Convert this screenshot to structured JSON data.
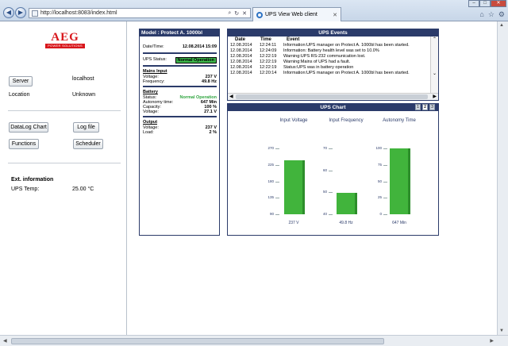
{
  "browser": {
    "url": "http://localhost:8083/index.html",
    "tab_title": "UPS View Web client",
    "tab_close": "✕",
    "min": "–",
    "max": "□",
    "close": "✕"
  },
  "sidebar": {
    "logo_text": "AEG",
    "logo_sub": "POWER SOLUTIONS",
    "server_btn": "Server",
    "server_value": "localhost",
    "location_label": "Location",
    "location_value": "Unknown",
    "datalog_btn": "DataLog Chart",
    "logfile_btn": "Log file",
    "functions_btn": "Functions",
    "scheduler_btn": "Scheduler",
    "ext_title": "Ext. information",
    "ups_temp_label": "UPS Temp:",
    "ups_temp_value": "25.00 °C"
  },
  "model": {
    "header": "Model : Protect A. 1000bl",
    "datetime_label": "Date/Time:",
    "datetime_value": "12.08.2014 15:09",
    "status_label": "UPS Status:",
    "status_value": "Normal Operation",
    "mains_title": "Mains Input",
    "voltage_label": "Voltage:",
    "mains_voltage": "237 V",
    "frequency_label": "Frequency:",
    "mains_frequency": "49.8 Hz",
    "battery_title": "Battery",
    "bstatus_label": "Status:",
    "battery_status": "Normal Operation",
    "autonomy_label": "Autonomy time:",
    "battery_autonomy": "647 Min",
    "capacity_label": "Capacity:",
    "battery_capacity": "100 %",
    "bvoltage_label": "Voltage:",
    "battery_voltage": "27.1 V",
    "output_title": "Output",
    "ovoltage_label": "Voltage:",
    "output_voltage": "237 V",
    "load_label": "Load:",
    "output_load": "2 %"
  },
  "events": {
    "header": "UPS Events",
    "col_date": "Date",
    "col_time": "Time",
    "col_event": "Event",
    "rows": [
      {
        "date": "12.08.2014",
        "time": "12:24:11",
        "event": "Information:UPS manager on Protect A. 1000bl has been started."
      },
      {
        "date": "12.08.2014",
        "time": "12:24:09",
        "event": "Information: Battery health level was set to 10.0%"
      },
      {
        "date": "12.08.2014",
        "time": "12:22:19",
        "event": "Warning:UPS RS-232 communication lost."
      },
      {
        "date": "12.08.2014",
        "time": "12:22:19",
        "event": "Warning:Mains of UPS had a fault."
      },
      {
        "date": "12.08.2014",
        "time": "12:22:19",
        "event": "Status:UPS was in battery operation"
      },
      {
        "date": "12.08.2014",
        "time": "12:20:14",
        "event": "Information:UPS manager on Protect A. 1000bl has been started."
      }
    ]
  },
  "chart_data": {
    "type": "bar",
    "title": "UPS Chart",
    "pages": [
      "1",
      "2",
      "3"
    ],
    "current_page": "2",
    "panels": [
      {
        "title": "Input Voltage",
        "ticks": [
          "270",
          "225",
          "180",
          "135",
          "90"
        ],
        "ylim": [
          90,
          270
        ],
        "value": 237,
        "value_label": "237 V"
      },
      {
        "title": "Input Frequency",
        "ticks": [
          "70",
          "60",
          "50",
          "40"
        ],
        "ylim": [
          40,
          70
        ],
        "value": 49.8,
        "value_label": "49.8 Hz"
      },
      {
        "title": "Autonomy Time",
        "ticks": [
          "100",
          "75",
          "50",
          "25",
          "0"
        ],
        "ylim": [
          0,
          100
        ],
        "value": 100,
        "value_label": "647 Min"
      }
    ]
  },
  "colors": {
    "header": "#2b3b6a",
    "bar": "#41b43c",
    "status_green": "#3db84b",
    "logo_red": "#d8161b"
  }
}
